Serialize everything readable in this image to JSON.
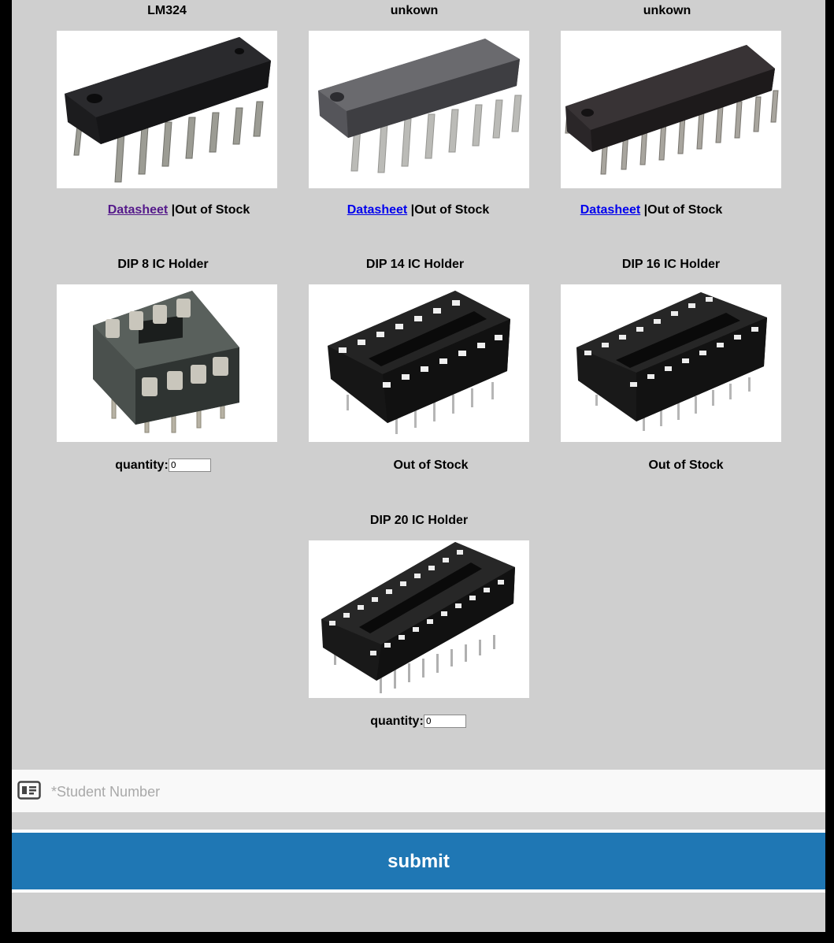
{
  "products": [
    {
      "title": "LM324",
      "image_icon": "dip14-ic-chip-icon",
      "datasheet_label": "Datasheet",
      "separator": "|",
      "status": "Out of Stock",
      "datasheet_visited": true
    },
    {
      "title": "unkown",
      "image_icon": "dip16-ic-chip-icon",
      "datasheet_label": "Datasheet",
      "separator": "|",
      "status": "Out of Stock",
      "datasheet_visited": false
    },
    {
      "title": "unkown",
      "image_icon": "dip20-ic-chip-icon",
      "datasheet_label": "Datasheet",
      "separator": "|",
      "status": "Out of Stock",
      "datasheet_visited": false
    },
    {
      "title": "DIP 8 IC Holder",
      "image_icon": "dip8-socket-icon",
      "quantity_label": "quantity:",
      "quantity_value": "0"
    },
    {
      "title": "DIP 14 IC Holder",
      "image_icon": "dip14-socket-icon",
      "status": "Out of Stock"
    },
    {
      "title": "DIP 16 IC Holder",
      "image_icon": "dip16-socket-icon",
      "status": "Out of Stock"
    },
    {
      "title": "DIP 20 IC Holder",
      "image_icon": "dip20-socket-icon",
      "quantity_label": "quantity:",
      "quantity_value": "0"
    }
  ],
  "form": {
    "student_number_placeholder": "*Student Number",
    "student_icon": "id-card-icon",
    "submit_label": "submit"
  },
  "colors": {
    "page_background": "#cfcfcf",
    "submit_button": "#1f77b4",
    "visited_link": "#551a8b",
    "link": "#0000ee"
  }
}
